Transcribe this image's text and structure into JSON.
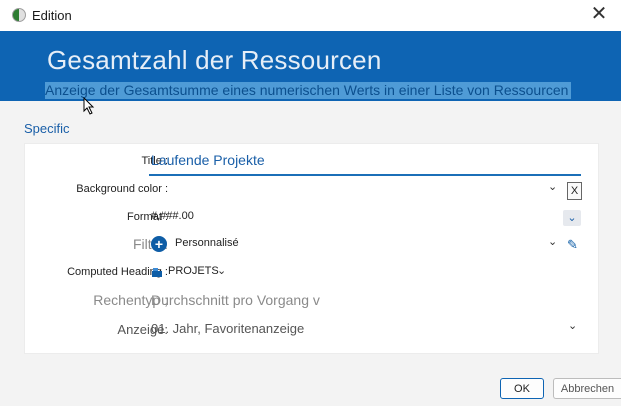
{
  "window": {
    "title": "Edition",
    "close_glyph": "✕"
  },
  "banner": {
    "title": "Gesamtzahl der Ressourcen",
    "subtitle": "Anzeige der Gesamtsumme eines numerischen Werts in einer Liste von Ressourcen"
  },
  "section": {
    "label": "Specific"
  },
  "fields": {
    "title": {
      "label": "Title :",
      "value": "Laufende Projekte"
    },
    "background": {
      "label": "Background color :",
      "clear": "X"
    },
    "format": {
      "label": "Format :",
      "value": "#,###.00"
    },
    "filter": {
      "label": "Filter:",
      "value": "Personnalisé"
    },
    "computed": {
      "label": "Computed Heading :",
      "value": "PROJETS"
    },
    "rechentyp": {
      "label": "Rechentyp ;",
      "value": "Durchschnitt pro Vorgang v"
    },
    "anzeige": {
      "label": "Anzeige:",
      "value": "01. Jahr, Favoritenanzeige"
    }
  },
  "icons": {
    "dropdown": "⌄",
    "chevron": "⌄",
    "plus": "+",
    "pencil": "✎"
  },
  "buttons": {
    "ok": "OK",
    "cancel": "Abbrechen"
  },
  "colors": {
    "accent": "#0e64b3",
    "accent_text": "#1a5fa8"
  }
}
